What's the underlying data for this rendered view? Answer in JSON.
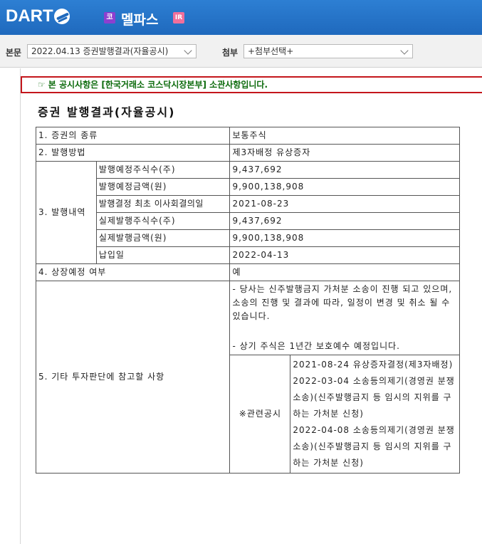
{
  "header": {
    "logo": "DART",
    "company_badge": "코",
    "company_name": "멜파스",
    "ir_badge": "IR"
  },
  "selectors": {
    "main_label": "본문",
    "main_value": "2022.04.13  증권발행결과(자율공시)",
    "attach_label": "첨부",
    "attach_value": "+첨부선택+"
  },
  "notice": {
    "icon": "hand-point-icon",
    "text": "본 공시사항은 [한국거래소 코스닥시장본부] 소관사항입니다."
  },
  "document": {
    "title": "증권  발행결과(자율공시)",
    "rows": {
      "r1": {
        "label": "1. 증권의 종류",
        "value": "보통주식"
      },
      "r2": {
        "label": "2. 발행방법",
        "value": "제3자배정 유상증자"
      },
      "r3": {
        "label": "3. 발행내역",
        "items": [
          {
            "label": "발행예정주식수(주)",
            "value": "9,437,692"
          },
          {
            "label": "발행예정금액(원)",
            "value": "9,900,138,908"
          },
          {
            "label": "발행결정 최초 이사회결의일",
            "value": "2021-08-23"
          },
          {
            "label": "실제발행주식수(주)",
            "value": "9,437,692"
          },
          {
            "label": "실제발행금액(원)",
            "value": "9,900,138,908"
          },
          {
            "label": "납입일",
            "value": "2022-04-13"
          }
        ]
      },
      "r4": {
        "label": "4. 상장예정 여부",
        "value": "예"
      },
      "r5": {
        "label": "5. 기타 투자판단에 참고할 사항",
        "remark_1": "- 당사는 신주발행금지 가처분 소송이 진행 되고 있으며, 소송의 진행 및 결과에 따라, 일정이 변경 및 취소 될 수 있습니다.",
        "remark_2": "- 상기 주식은 1년간 보호예수 예정입니다.",
        "related_label": "※관련공시",
        "related": [
          "2021-08-24 유상증자결정(제3자배정)",
          "2022-03-04 소송등의제기(경영권 분쟁 소송)(신주발행금지 등 임시의 지위를 구하는 가처분 신청)",
          "2022-04-08 소송등의제기(경영권 분쟁 소송)(신주발행금지 등 임시의 지위를 구하는 가처분 신청)"
        ]
      }
    }
  }
}
